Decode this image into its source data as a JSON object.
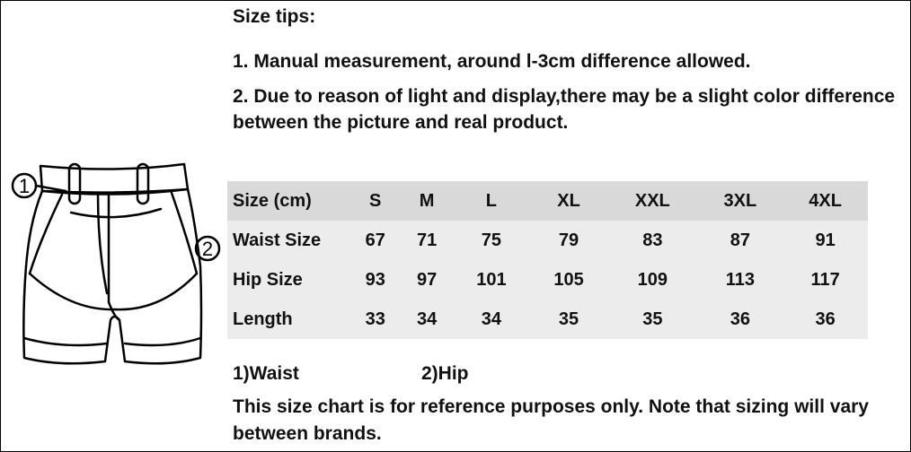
{
  "tips": {
    "title": "Size tips:",
    "items": [
      "1. Manual measurement, around l-3cm difference allowed.",
      "2. Due to reason of light and display,there may be a slight color difference between the picture and real product."
    ]
  },
  "diagram": {
    "icon": "shorts-outline-icon",
    "marker_1": "1",
    "marker_2": "2"
  },
  "table": {
    "header_label": "Size (cm)",
    "sizes": [
      "S",
      "M",
      "L",
      "XL",
      "XXL",
      "3XL",
      "4XL"
    ],
    "rows": [
      {
        "label": "Waist Size",
        "values": [
          "67",
          "71",
          "75",
          "79",
          "83",
          "87",
          "91"
        ]
      },
      {
        "label": "Hip Size",
        "values": [
          "93",
          "97",
          "101",
          "105",
          "109",
          "113",
          "117"
        ]
      },
      {
        "label": "Length",
        "values": [
          "33",
          "34",
          "34",
          "35",
          "35",
          "36",
          "36"
        ]
      }
    ]
  },
  "legend": {
    "waist": "1)Waist",
    "hip": "2)Hip"
  },
  "note": "This size chart is for reference purposes only. Note that sizing will vary between brands.",
  "colors": {
    "header_bg": "#d9d9d9",
    "row_bg": "#ececec",
    "text": "#111111",
    "border": "#000000"
  }
}
